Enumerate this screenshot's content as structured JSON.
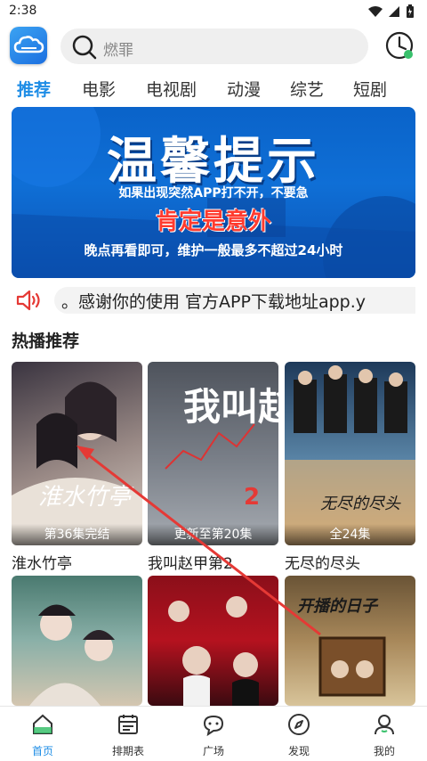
{
  "status_bar": {
    "time": "2:38"
  },
  "search": {
    "placeholder": "燃罪"
  },
  "categories": [
    {
      "label": "推荐",
      "active": true
    },
    {
      "label": "电影"
    },
    {
      "label": "电视剧"
    },
    {
      "label": "动漫"
    },
    {
      "label": "综艺"
    },
    {
      "label": "短剧"
    }
  ],
  "banner": {
    "title": "温馨提示",
    "line1": "如果出现突然APP打不开，不要急",
    "line2": "肯定是意外",
    "line3": "晚点再看即可，维护一般最多不超过24小时"
  },
  "notice": {
    "text": "。感谢你的使用      官方APP下载地址app.y"
  },
  "hot": {
    "title": "热播推荐",
    "items": [
      {
        "title": "淮水竹亭",
        "badge": "第36集完结",
        "poster_text": "淮水竹亭",
        "colors": [
          "#3a3440",
          "#9a8a86",
          "#d9cfc6"
        ]
      },
      {
        "title": "我叫赵甲第2",
        "badge": "更新至第20集",
        "poster_text": "我叫赵甲第",
        "colors": [
          "#4a4e58",
          "#8a8f99",
          "#c9cdd3"
        ]
      },
      {
        "title": "无尽的尽头",
        "badge": "全24集",
        "poster_text": "无尽的尽头",
        "colors": [
          "#1e3a5a",
          "#5b86a8",
          "#c8a070"
        ]
      },
      {
        "title": "",
        "badge": "",
        "poster_text": "",
        "colors": [
          "#4a7a70",
          "#8ab0a8",
          "#d4c6b0"
        ]
      },
      {
        "title": "",
        "badge": "",
        "poster_text": "",
        "colors": [
          "#8b0f1a",
          "#b5121f",
          "#3a0a10"
        ]
      },
      {
        "title": "",
        "badge": "",
        "poster_text": "开播的日子",
        "colors": [
          "#6a5436",
          "#a8885a",
          "#d8c49a"
        ]
      }
    ]
  },
  "nav": [
    {
      "label": "首页",
      "icon": "home-icon",
      "active": true
    },
    {
      "label": "排期表",
      "icon": "calendar-icon"
    },
    {
      "label": "广场",
      "icon": "chat-icon"
    },
    {
      "label": "发现",
      "icon": "compass-icon"
    },
    {
      "label": "我的",
      "icon": "user-icon"
    }
  ],
  "colors": {
    "accent": "#1e8de6",
    "banner": "#0a63c9",
    "notice_icon": "#e53935",
    "arrow": "#e53935"
  }
}
